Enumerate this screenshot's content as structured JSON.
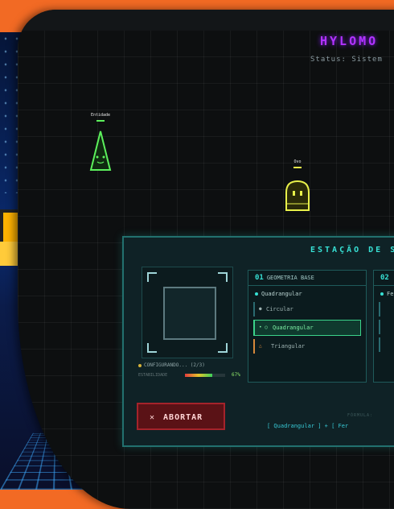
{
  "app": {
    "title": "HYLOMO",
    "status": "Status: Sistem"
  },
  "entities": [
    {
      "label": "Entidade",
      "color": "#5cf05c"
    },
    {
      "label": "Ovo",
      "color": "#e8f04a"
    }
  ],
  "station": {
    "title": "ESTAÇÃO DE S",
    "preview": {
      "configuring": "CONFIGURANDO... (2/3)",
      "stability_label": "ESTABILIDADE",
      "stability_value": "67%",
      "stability_fraction": 0.67
    },
    "column1": {
      "number": "01",
      "title": "GEOMETRIA BASE",
      "current": "Quadrangular",
      "options": [
        {
          "label": "Circular",
          "icon": "circle-icon"
        },
        {
          "label": "Quadrangular",
          "icon": "square-icon",
          "selected": true
        },
        {
          "label": "Triangular",
          "icon": "triangle-icon"
        }
      ]
    },
    "column2": {
      "number": "02",
      "current": "Fe"
    },
    "abort_label": "ABORTAR",
    "formula_label": "FÓRMULA:",
    "formula": "[ Quadrangular ] + [ Fer"
  },
  "colors": {
    "accent": "#37e0d4",
    "title": "#b233ff",
    "danger": "#a4232b",
    "selected": "#3bd38a",
    "frame": "#f26a24"
  }
}
